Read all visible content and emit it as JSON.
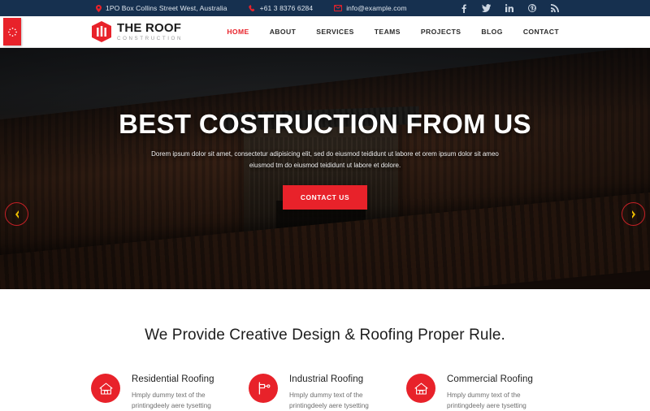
{
  "topbar": {
    "address": "1PO Box Collins Street West, Australia",
    "phone": "+61 3 8376 6284",
    "email": "info@example.com",
    "address_icon": "map-marker-icon",
    "phone_icon": "phone-icon",
    "email_icon": "envelope-icon",
    "social": [
      {
        "name": "facebook-icon",
        "label": "f"
      },
      {
        "name": "twitter-icon",
        "label": "t"
      },
      {
        "name": "linkedin-icon",
        "label": "in"
      },
      {
        "name": "pinterest-icon",
        "label": "p"
      },
      {
        "name": "rss-icon",
        "label": "rss"
      }
    ],
    "background_color": "#16304f",
    "icon_color": "#e8222a"
  },
  "header": {
    "side_tab_icon": "settings-gear-icon",
    "logo": {
      "mark": "roof-hexagon-logo-icon",
      "title": "THE ROOF",
      "subtitle": "CONSTRUCTION"
    },
    "nav": [
      {
        "label": "HOME",
        "active": true
      },
      {
        "label": "ABOUT",
        "active": false
      },
      {
        "label": "SERVICES",
        "active": false
      },
      {
        "label": "TEAMS",
        "active": false
      },
      {
        "label": "PROJECTS",
        "active": false
      },
      {
        "label": "BLOG",
        "active": false
      },
      {
        "label": "CONTACT",
        "active": false
      }
    ],
    "accent_color": "#e8222a"
  },
  "hero": {
    "title": "BEST COSTRUCTION FROM US",
    "description": "Dorem ipsum dolor sit amet, consectetur adipisicing elit, sed do eiusmod teididunt ut labore et orem ipsum dolor sit ameo eiusmod tm do eiusmod teididunt ut labore et dolore.",
    "button_label": "CONTACT US",
    "prev_arrow_icon": "chevron-left-icon",
    "next_arrow_icon": "chevron-right-icon",
    "arrow_color": "#f2c200",
    "arrow_border_color": "#c32026",
    "button_color": "#e8222a"
  },
  "services": {
    "heading": "We Provide Creative Design & Roofing Proper Rule.",
    "items": [
      {
        "icon": "home-roof-icon",
        "title": "Residential Roofing",
        "text": "Hmply dummy text of the printingdeely aere tysetting"
      },
      {
        "icon": "roof-tool-icon",
        "title": "Industrial Roofing",
        "text": "Hmply dummy text of the printingdeely aere tysetting"
      },
      {
        "icon": "home-roof-icon",
        "title": "Commercial Roofing",
        "text": "Hmply dummy text of the printingdeely aere tysetting"
      }
    ],
    "icon_background": "#e8222a"
  }
}
